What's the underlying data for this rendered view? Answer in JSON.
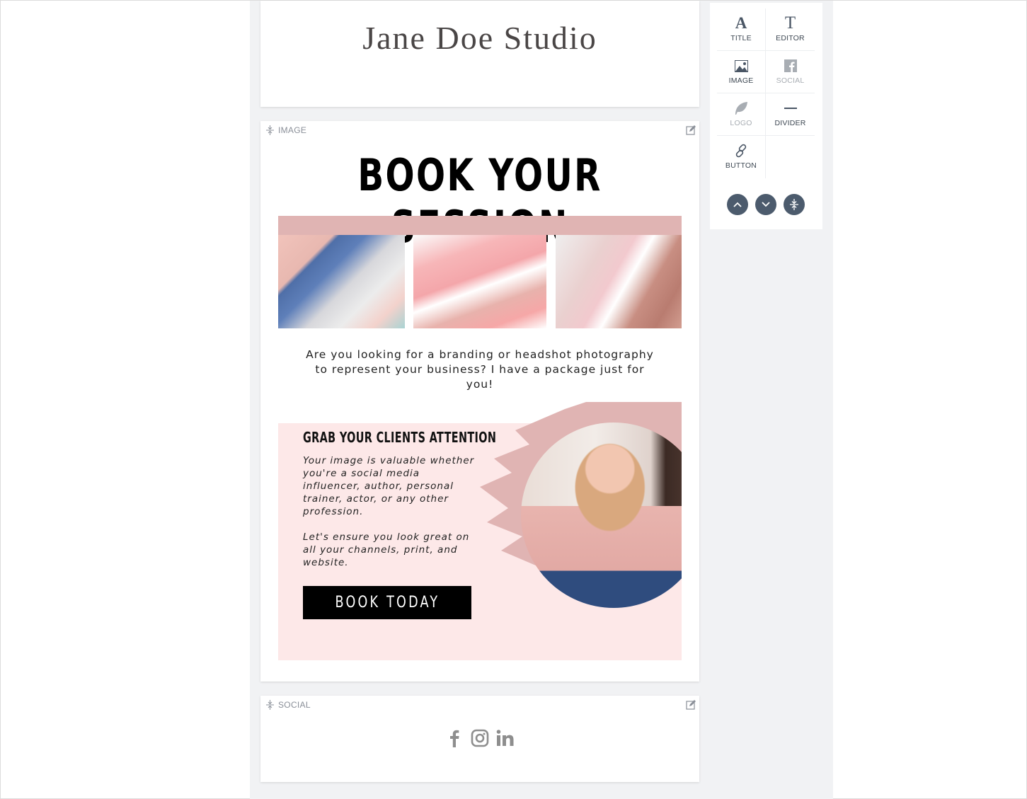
{
  "title_block": {
    "brand_title": "Jane Doe Studio"
  },
  "image_block": {
    "label": "IMAGE",
    "headline": "BOOK YOUR SESSION",
    "intro": "Are you looking for a branding or headshot photography to represent your business? I have a package just for you!",
    "promo": {
      "heading": "GRAB YOUR CLIENTS ATTENTION",
      "paragraphs": [
        "Your image is valuable whether you're a social media influencer, author, personal trainer, actor, or any other profession.",
        "Let's ensure you look great on all your channels, print, and website."
      ],
      "button_label": "BOOK TODAY"
    },
    "colors": {
      "accent_pink": "#e0b4b3",
      "promo_background": "#fde8e8",
      "button_background": "#000000"
    }
  },
  "social_block": {
    "label": "SOCIAL",
    "icons": [
      "facebook-icon",
      "instagram-icon",
      "linkedin-icon"
    ]
  },
  "tool_panel": {
    "tools": [
      {
        "label": "TITLE",
        "icon": "title-icon",
        "enabled": true
      },
      {
        "label": "EDITOR",
        "icon": "editor-icon",
        "enabled": true
      },
      {
        "label": "IMAGE",
        "icon": "image-icon",
        "enabled": true
      },
      {
        "label": "SOCIAL",
        "icon": "facebook-icon",
        "enabled": false
      },
      {
        "label": "LOGO",
        "icon": "leaf-icon",
        "enabled": false
      },
      {
        "label": "DIVIDER",
        "icon": "divider-icon",
        "enabled": true
      },
      {
        "label": "BUTTON",
        "icon": "link-icon",
        "enabled": true
      }
    ],
    "actions": [
      "move-up",
      "move-down",
      "collapse"
    ],
    "action_color": "#4c5b6d"
  }
}
